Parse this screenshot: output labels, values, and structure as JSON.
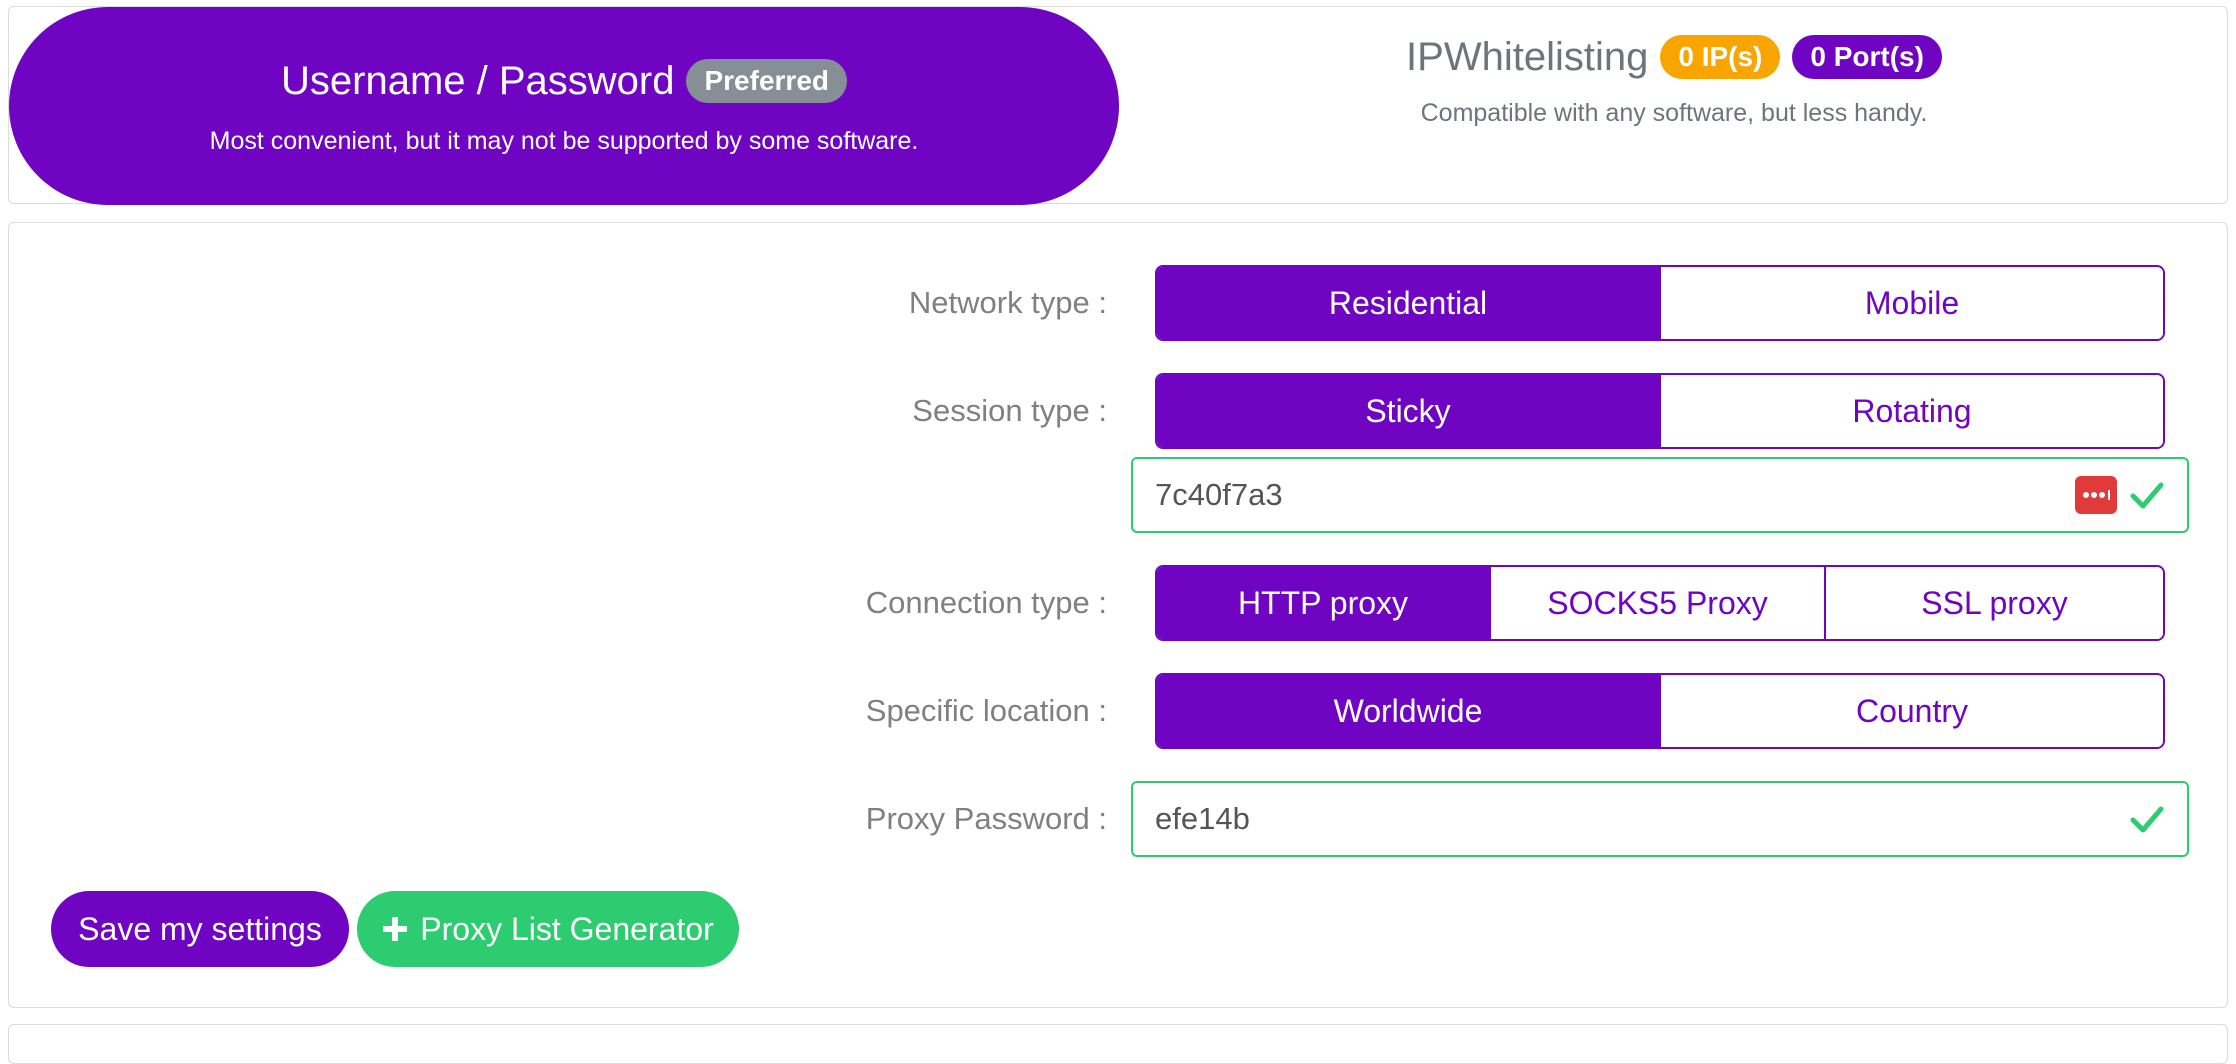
{
  "auth": {
    "userpass": {
      "title": "Username / Password",
      "badge": "Preferred",
      "description": "Most convenient, but it may not be supported by some software."
    },
    "ipwhitelisting": {
      "title": "IPWhitelisting",
      "ip_badge": "0 IP(s)",
      "port_badge": "0 Port(s)",
      "description": "Compatible with any software, but less handy."
    }
  },
  "settings": {
    "network_type": {
      "label": "Network type :",
      "options": [
        "Residential",
        "Mobile"
      ],
      "selected": "Residential"
    },
    "session_type": {
      "label": "Session type :",
      "options": [
        "Sticky",
        "Rotating"
      ],
      "selected": "Sticky",
      "session_id": "7c40f7a3"
    },
    "connection_type": {
      "label": "Connection type :",
      "options": [
        "HTTP proxy",
        "SOCKS5 Proxy",
        "SSL proxy"
      ],
      "selected": "HTTP proxy"
    },
    "specific_location": {
      "label": "Specific location :",
      "options": [
        "Worldwide",
        "Country"
      ],
      "selected": "Worldwide"
    },
    "proxy_password": {
      "label": "Proxy Password :",
      "value": "efe14b"
    }
  },
  "actions": {
    "save_label": "Save my settings",
    "generator_label": "Proxy List Generator"
  },
  "colors": {
    "primary": "#6f05c3",
    "success": "#2ecc71",
    "warning": "#f8a500",
    "muted": "#868e96",
    "danger": "#e03a3a"
  },
  "icons": {
    "check": "check-icon",
    "password_manager": "password-manager-icon",
    "plus": "plus-icon"
  }
}
